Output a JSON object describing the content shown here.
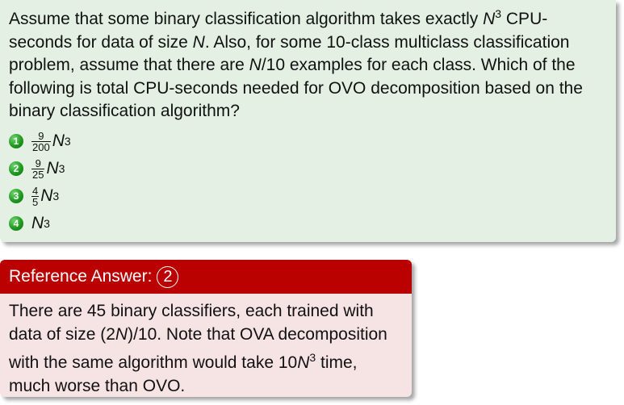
{
  "question": {
    "line1_pre": "Assume that some binary classification algorithm takes exactly ",
    "var_N": "N",
    "exp_3": "3",
    "line1_post": "CPU-seconds for data of size ",
    "line2_post": ". Also, for some 10-class multiclass classification problem, assume that there are ",
    "n_over_10": "N",
    "line3_mid": "/10 examples for each class. Which of the following is total CPU-seconds needed for OVO decomposition based on the binary classification algorithm?"
  },
  "options": [
    {
      "bullet": "1",
      "num": "9",
      "den": "200",
      "var": "N",
      "exp": "3"
    },
    {
      "bullet": "2",
      "num": "9",
      "den": "25",
      "var": "N",
      "exp": "3"
    },
    {
      "bullet": "3",
      "num": "4",
      "den": "5",
      "var": "N",
      "exp": "3"
    },
    {
      "bullet": "4",
      "var": "N",
      "exp": "3"
    }
  ],
  "answer": {
    "header": "Reference Answer:",
    "choice": "2",
    "text1": "There are 45 binary classifiers, each trained with data of size (2",
    "var": "N",
    "text2": ")/10. Note that OVA decomposition with the same algorithm would take 10",
    "var2": "N",
    "exp": "3",
    "text3": " time, much worse than OVO."
  },
  "colors": {
    "question_bg": "#e3f0e3",
    "answer_header": "#bb0000",
    "answer_bg": "#f6e3e3",
    "bullet": "#1f9a1f"
  }
}
